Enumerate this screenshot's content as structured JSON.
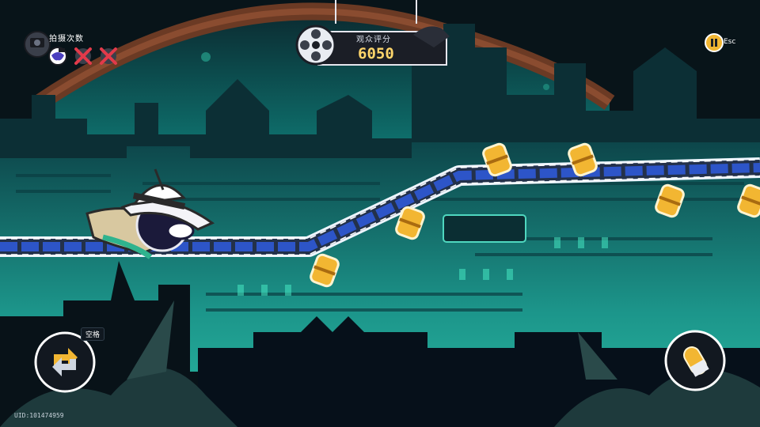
{
  "hud": {
    "attempts_label": "拍摄次数",
    "attempts": [
      {
        "state": "remaining",
        "icon": "camera-ghost-icon"
      },
      {
        "state": "used",
        "icon": "crossed-camera-icon"
      },
      {
        "state": "used",
        "icon": "crossed-camera-icon"
      }
    ],
    "score_label": "观众评分",
    "score_value": "6050",
    "pause_key": "Esc",
    "jump_key": "空格",
    "uid": "UID:101474959"
  },
  "icons": {
    "film_reel": "film-reel-icon",
    "pause": "pause-icon",
    "switch": "swap-arrows-icon",
    "bullet": "bullet-icon"
  },
  "colors": {
    "accent_gold": "#f2b632",
    "score_gold": "#ffd66b",
    "rail_blue": "#2d55c8",
    "city_teal": "#1bb9a6",
    "sky_teal": "#0f8d86",
    "panel_dark": "#1b1e26"
  }
}
